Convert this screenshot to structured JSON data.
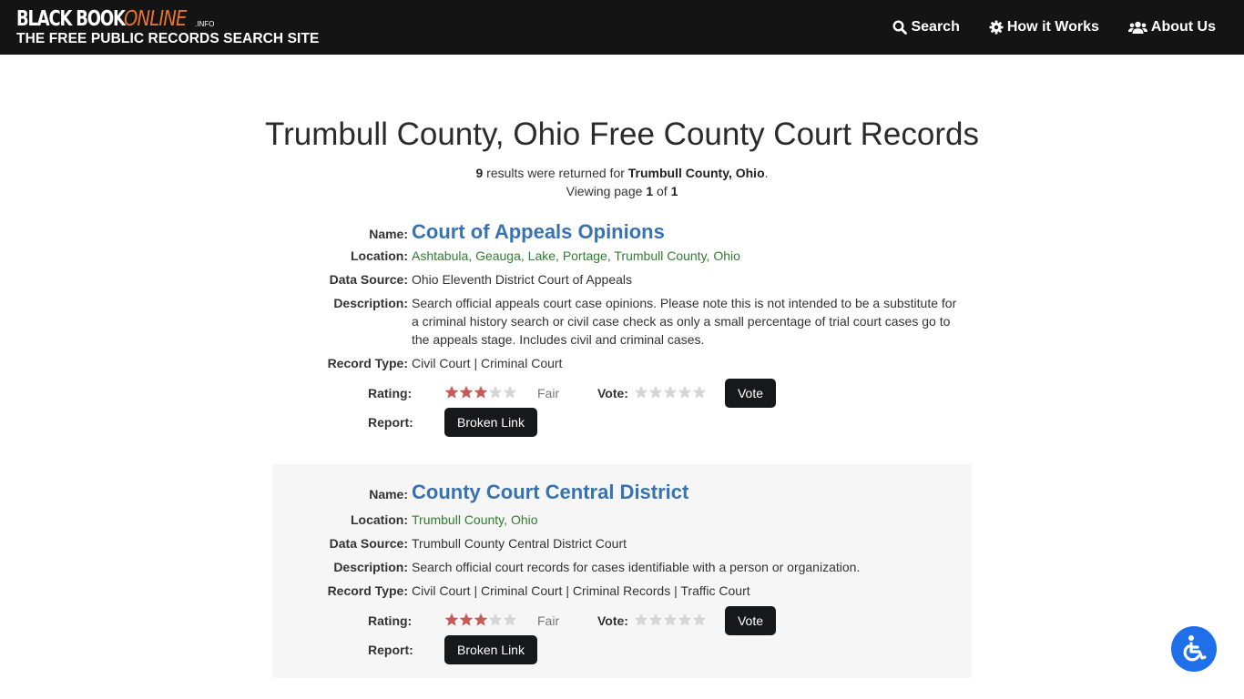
{
  "header": {
    "logo_black": "BLACK BOOK",
    "logo_online": "ONLINE",
    "logo_info": ".INFO",
    "tagline": "THE FREE PUBLIC RECORDS SEARCH SITE",
    "nav": [
      {
        "label": "Search",
        "icon": "search-icon"
      },
      {
        "label": "How it Works",
        "icon": "gear-icon"
      },
      {
        "label": "About Us",
        "icon": "users-icon"
      }
    ]
  },
  "page": {
    "title": "Trumbull County, Ohio Free County Court Records",
    "result_count": "9",
    "results_text": " results were returned for ",
    "query": "Trumbull County, Ohio",
    "period": ".",
    "viewing_prefix": "Viewing page ",
    "page_current": "1",
    "page_of": " of ",
    "page_total": "1"
  },
  "labels": {
    "name": "Name:",
    "location": "Location:",
    "data_source": "Data Source:",
    "description": "Description:",
    "record_type": "Record Type:",
    "rating": "Rating:",
    "vote": "Vote:",
    "report": "Report:",
    "vote_button": "Vote",
    "broken_link_button": "Broken Link"
  },
  "records": [
    {
      "name": "Court of Appeals Opinions",
      "locations": [
        "Ashtabula",
        "Geauga",
        "Lake",
        "Portage",
        "Trumbull County",
        "Ohio"
      ],
      "data_source": "Ohio Eleventh District Court of Appeals",
      "description": "Search official appeals court case opinions. Please note this is not intended to be a substitute for a criminal history search or civil case check as only a small percentage of trial court cases go to the appeals stage. Includes civil and criminal cases.",
      "record_type": "Civil Court | Criminal Court",
      "rating_stars": 3,
      "rating_max": 5,
      "rating_text": "Fair"
    },
    {
      "name": "County Court Central District",
      "locations": [
        "Trumbull County",
        "Ohio"
      ],
      "data_source": "Trumbull County Central District Court",
      "description": "Search official court records for cases identifiable with a person or organization.",
      "record_type": "Civil Court | Criminal Court | Criminal Records | Traffic Court",
      "rating_stars": 3,
      "rating_max": 5,
      "rating_text": "Fair"
    }
  ],
  "colors": {
    "topbar": "#141414",
    "logo_accent": "#e8742f",
    "link_blue": "#3773b0",
    "location_green": "#2f7d2f",
    "star_filled": "#c85a5a",
    "star_empty": "#d6d6d6",
    "button_dark": "#16191b",
    "accessibility_blue": "#1f6fe8"
  },
  "accessibility": {
    "icon": "wheelchair-icon"
  }
}
